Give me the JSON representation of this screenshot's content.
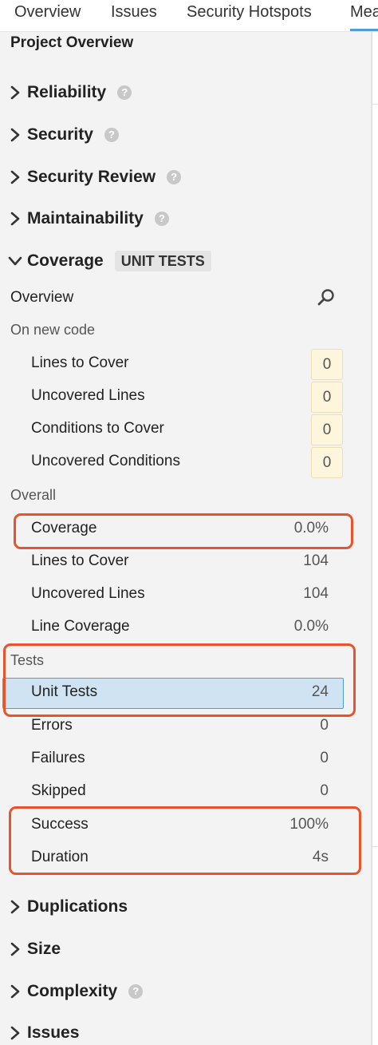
{
  "tabs": [
    "Overview",
    "Issues",
    "Security Hotspots",
    "Mea"
  ],
  "active_tab": 3,
  "accent_color": "#4b9fd5",
  "highlight_color": "#e8532b",
  "project_title": "Project Overview",
  "domains_top": [
    {
      "label": "Reliability",
      "help": true
    },
    {
      "label": "Security",
      "help": true
    },
    {
      "label": "Security Review",
      "help": true
    },
    {
      "label": "Maintainability",
      "help": true
    }
  ],
  "coverage": {
    "label": "Coverage",
    "badge": "UNIT TESTS",
    "overview": "Overview",
    "new_code_header": "On new code",
    "new_code": [
      {
        "label": "Lines to Cover",
        "value": "0"
      },
      {
        "label": "Uncovered Lines",
        "value": "0"
      },
      {
        "label": "Conditions to Cover",
        "value": "0"
      },
      {
        "label": "Uncovered Conditions",
        "value": "0"
      }
    ],
    "overall_header": "Overall",
    "overall": [
      {
        "label": "Coverage",
        "value": "0.0%"
      },
      {
        "label": "Lines to Cover",
        "value": "104"
      },
      {
        "label": "Uncovered Lines",
        "value": "104"
      },
      {
        "label": "Line Coverage",
        "value": "0.0%"
      }
    ],
    "tests_header": "Tests",
    "tests": [
      {
        "label": "Unit Tests",
        "value": "24",
        "selected": true
      },
      {
        "label": "Errors",
        "value": "0"
      },
      {
        "label": "Failures",
        "value": "0"
      },
      {
        "label": "Skipped",
        "value": "0"
      },
      {
        "label": "Success",
        "value": "100%"
      },
      {
        "label": "Duration",
        "value": "4s"
      }
    ]
  },
  "domains_bottom": [
    {
      "label": "Duplications",
      "help": false
    },
    {
      "label": "Size",
      "help": false
    },
    {
      "label": "Complexity",
      "help": true
    },
    {
      "label": "Issues",
      "help": false
    }
  ],
  "icons": {
    "expand": "chevron-right-icon",
    "collapse": "chevron-down-icon",
    "help": "question-circle-icon",
    "help_glyph": "?",
    "search": "search-icon"
  }
}
